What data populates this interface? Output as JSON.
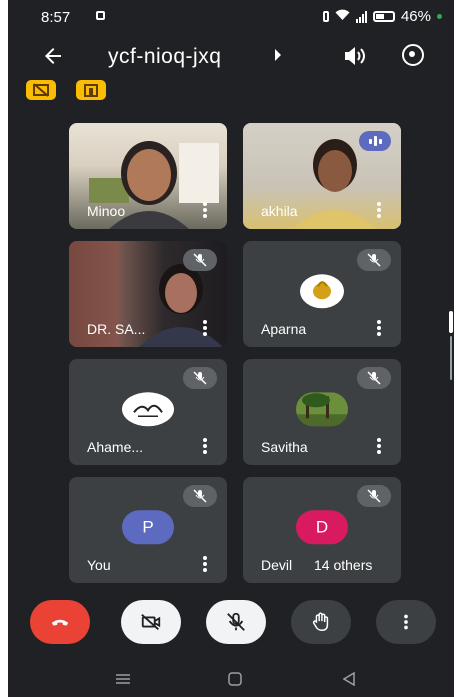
{
  "status": {
    "time": "8:57",
    "battery": "46%"
  },
  "header": {
    "meeting_code": "ycf-nioq-jxq"
  },
  "participants": [
    {
      "name": "Minoo",
      "muted": false
    },
    {
      "name": "akhila",
      "muted": false,
      "speaking": true
    },
    {
      "name": "DR. SA...",
      "muted": true
    },
    {
      "name": "Aparna",
      "muted": true
    },
    {
      "name": "Ahame...",
      "muted": true
    },
    {
      "name": "Savitha",
      "muted": true
    },
    {
      "name": "You",
      "muted": true,
      "initial": "P",
      "avatar_color": "#5c6bc0"
    },
    {
      "name": "Devil",
      "muted": true,
      "initial": "D",
      "avatar_color": "#d81b60"
    }
  ],
  "others_label": "14 others",
  "colors": {
    "background": "#202124",
    "tile": "#3c4043",
    "end_call": "#ea4335",
    "badge": "#fbbc04",
    "speaking": "#5c6bc0"
  },
  "icons": {
    "back": "arrow-left-icon",
    "speaker": "volume-icon",
    "switch_camera": "switch-camera-icon",
    "end_call": "phone-hangup-icon",
    "camera": "video-off-icon",
    "mic": "mic-off-icon",
    "hand": "raise-hand-icon",
    "more": "more-vert-icon"
  }
}
